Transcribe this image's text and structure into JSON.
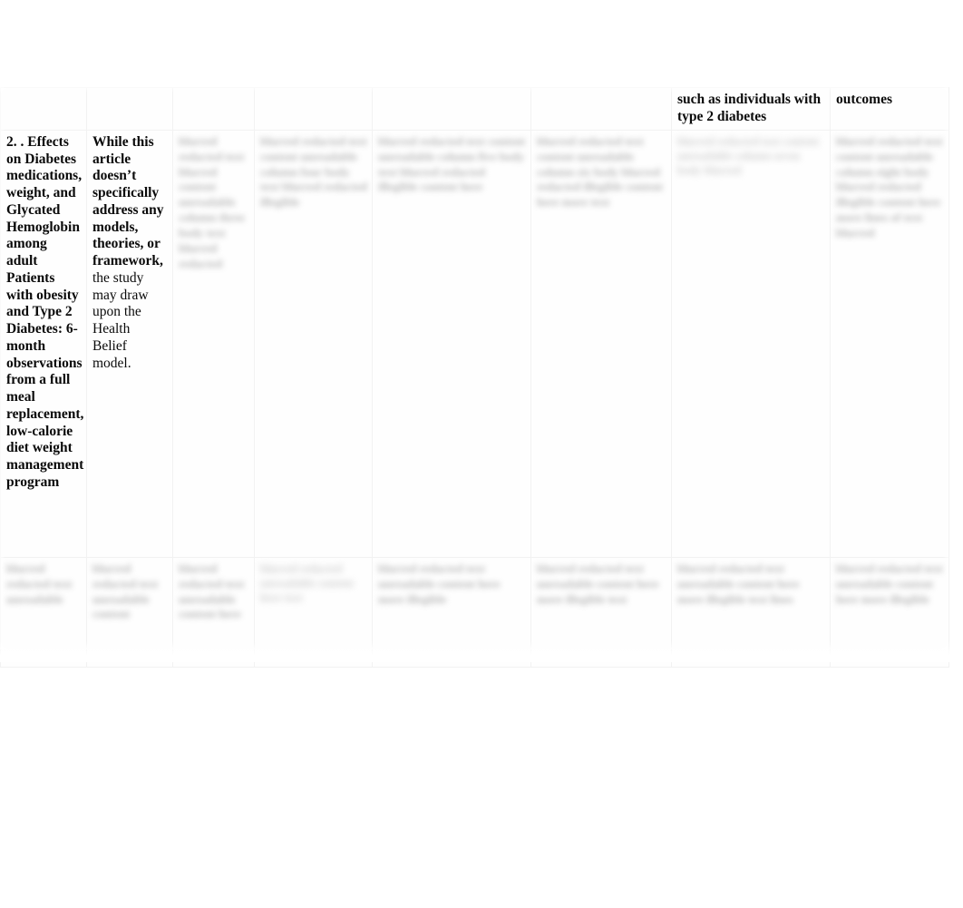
{
  "document": {
    "type": "literature-matrix-table",
    "page_background": "#ffffff",
    "table_background": "#fefefe",
    "border_color": "#f2f2f2"
  },
  "table": {
    "column_count": 8,
    "row_count": 3,
    "header": {
      "cells": [
        {
          "text": "",
          "legible": false
        },
        {
          "text": "",
          "legible": false
        },
        {
          "text": "",
          "legible": false
        },
        {
          "text": "",
          "legible": false
        },
        {
          "text": "",
          "legible": false
        },
        {
          "text": "",
          "legible": false
        },
        {
          "text": "such as individuals with type 2 diabetes",
          "legible": true
        },
        {
          "text": "outcomes",
          "legible": true
        }
      ]
    },
    "rows": [
      {
        "name": "row-main",
        "cells": [
          {
            "legible": true,
            "text": "2. . Effects on Diabetes medications, weight, and Glycated Hemoglobin among adult Patients with obesity and Type 2 Diabetes: 6-month observations from a full meal replacement, low-calorie diet weight management program"
          },
          {
            "legible": true,
            "bold_part": "While this article doesn’t specifically address any models, theories, or framework,",
            "regular_part": " the study may draw upon the Health Belief model."
          },
          {
            "legible": false,
            "text": "blurred redacted text blurred content unreadable column three body text blurred redacted"
          },
          {
            "legible": false,
            "text": "blurred redacted text content unreadable column four body text blurred redacted illegible"
          },
          {
            "legible": false,
            "text": "blurred redacted text content unreadable column five body text blurred redacted illegible content here"
          },
          {
            "legible": false,
            "text": "blurred redacted text content unreadable column six body blurred redacted illegible content here more text"
          },
          {
            "legible": false,
            "text": "blurred redacted text content unreadable column seven body blurred"
          },
          {
            "legible": false,
            "text": "blurred redacted text content unreadable column eight body blurred redacted illegible content here more lines of text blurred"
          }
        ]
      },
      {
        "name": "row-last",
        "cells": [
          {
            "legible": false,
            "text": "blurred redacted text unreadable"
          },
          {
            "legible": false,
            "text": "blurred redacted text unreadable content"
          },
          {
            "legible": false,
            "text": "blurred redacted text unreadable content here"
          },
          {
            "legible": false,
            "text": "blurred redacted unreadable content here text"
          },
          {
            "legible": false,
            "text": "blurred redacted text unreadable content here more illegible"
          },
          {
            "legible": false,
            "text": "blurred redacted text unreadable content here more illegible text"
          },
          {
            "legible": false,
            "text": "blurred redacted text unreadable content here more illegible text lines"
          },
          {
            "legible": false,
            "text": "blurred redacted text unreadable content here more illegible"
          }
        ]
      }
    ]
  }
}
